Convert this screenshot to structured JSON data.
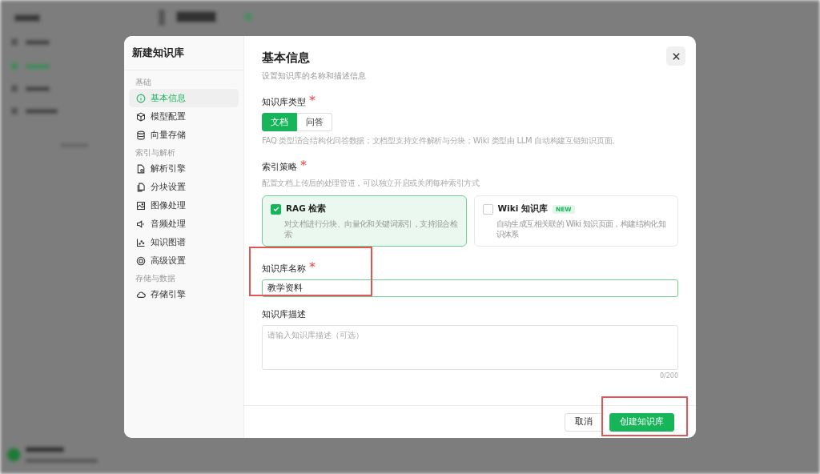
{
  "dialog": {
    "title": "新建知识库",
    "nav": [
      {
        "group": "基础",
        "items": [
          {
            "label": "基本信息",
            "selected": true
          },
          {
            "label": "模型配置",
            "selected": false
          },
          {
            "label": "向量存储",
            "selected": false
          }
        ]
      },
      {
        "group": "索引与解析",
        "items": [
          {
            "label": "解析引擎",
            "selected": false
          },
          {
            "label": "分块设置",
            "selected": false
          },
          {
            "label": "图像处理",
            "selected": false
          },
          {
            "label": "音频处理",
            "selected": false
          },
          {
            "label": "知识图谱",
            "selected": false
          },
          {
            "label": "高级设置",
            "selected": false
          }
        ]
      },
      {
        "group": "存储与数据",
        "items": [
          {
            "label": "存储引擎",
            "selected": false
          }
        ]
      }
    ],
    "section": {
      "title": "基本信息",
      "subtitle": "设置知识库的名称和描述信息"
    },
    "type_field": {
      "label": "知识库类型",
      "required_mark": "*",
      "options": [
        {
          "label": "文档",
          "selected": true
        },
        {
          "label": "问答",
          "selected": false
        }
      ],
      "hint": "FAQ 类型适合结构化问答数据；文档型支持文件解析与分块；Wiki 类型由 LLM 自动构建互链知识页面。"
    },
    "index_field": {
      "label": "索引策略",
      "required_mark": "*",
      "hint": "配置文档上传后的处理管道，可以独立开启或关闭每种索引方式",
      "options": [
        {
          "title": "RAG 检索",
          "checked": true,
          "desc": "对文档进行分块、向量化和关键词索引，支持混合检索"
        },
        {
          "title": "Wiki 知识库",
          "badge": "NEW",
          "checked": false,
          "desc": "自动生成互相关联的 Wiki 知识页面，构建结构化知识体系"
        }
      ]
    },
    "name_field": {
      "label": "知识库名称",
      "required_mark": "*",
      "value": "教学资料",
      "highlighted": true
    },
    "desc_field": {
      "label": "知识库描述",
      "placeholder": "请输入知识库描述（可选）",
      "counter": "0/200"
    },
    "buttons": [
      {
        "label": "取消",
        "kind": "secondary",
        "highlighted": false
      },
      {
        "label": "创建知识库",
        "kind": "primary",
        "highlighted": true
      }
    ]
  }
}
